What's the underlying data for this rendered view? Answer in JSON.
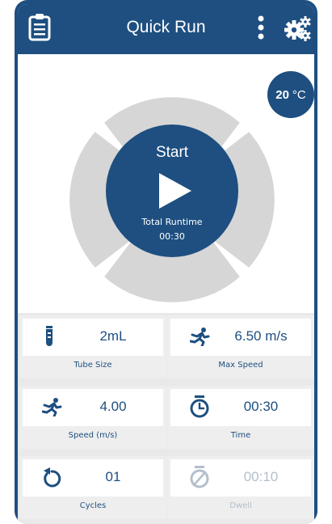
{
  "header": {
    "title": "Quick Run",
    "left_icon": "clipboard-icon",
    "menu_icon": "kebab-menu-icon",
    "settings_icon": "gears-icon"
  },
  "temperature": {
    "value": "20",
    "unit": "°C"
  },
  "start": {
    "label": "Start",
    "runtime_label": "Total Runtime",
    "runtime_value": "00:30"
  },
  "cards": [
    {
      "value": "2mL",
      "label": "Tube Size",
      "icon": "test-tube-icon",
      "enabled": true
    },
    {
      "value": "6.50 m/s",
      "label": "Max Speed",
      "icon": "runner-icon",
      "enabled": true
    },
    {
      "value": "4.00",
      "label": "Speed (m/s)",
      "icon": "runner-icon",
      "enabled": true
    },
    {
      "value": "00:30",
      "label": "Time",
      "icon": "stopwatch-icon",
      "enabled": true
    },
    {
      "value": "01",
      "label": "Cycles",
      "icon": "rotate-icon",
      "enabled": true
    },
    {
      "value": "00:10",
      "label": "Dwell",
      "icon": "stopwatch-disabled-icon",
      "enabled": false
    }
  ],
  "colors": {
    "primary": "#1e4f80",
    "ring": "#d6d6d6",
    "disabled": "#b3bfcb"
  }
}
